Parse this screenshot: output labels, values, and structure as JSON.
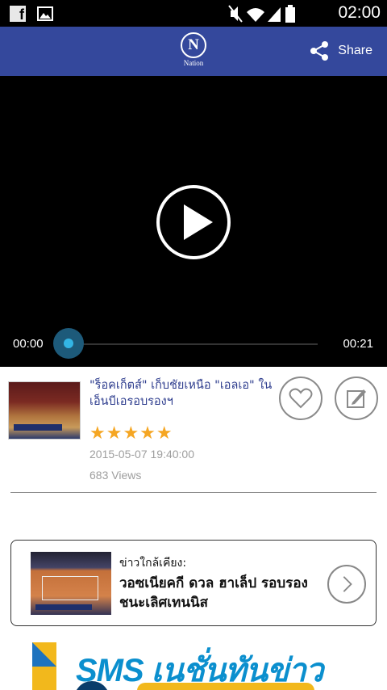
{
  "status_bar": {
    "time": "02:00",
    "left_icons": [
      "facebook-icon",
      "image-icon"
    ],
    "right_icons": [
      "mute-icon",
      "wifi-icon",
      "signal-icon",
      "battery-icon"
    ]
  },
  "app_bar": {
    "logo_letter": "N",
    "logo_text": "Nation",
    "share_label": "Share",
    "color": "#34489c"
  },
  "player": {
    "current_time": "00:00",
    "duration": "00:21",
    "progress": 0.0,
    "accent_color": "#33b5e5"
  },
  "video_info": {
    "title": "\"ร็อคเก็ตส์\" เก็บชัยเหนือ \"เอลเอ\" ในเอ็นบีเอรอบรองฯ",
    "rating_stars": "★★★★★",
    "rating": 5,
    "date": "2015-05-07 19:40:00",
    "views": "683 Views"
  },
  "related": {
    "label": "ข่าวใกล้เคียง:",
    "title": "วอซเนียคกี ดวล ฮาเล็ป รอบรองชนะเลิศเทนนิส"
  },
  "banner": {
    "text": "SMS เนชั่นทันข่าว"
  }
}
